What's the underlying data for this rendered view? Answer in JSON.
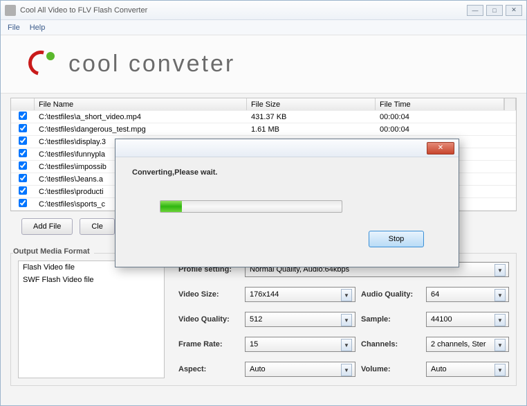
{
  "window": {
    "title": "Cool All Video to FLV Flash Converter"
  },
  "menu": {
    "file": "File",
    "help": "Help"
  },
  "logo": {
    "text": "cool conveter"
  },
  "table": {
    "headers": {
      "name": "File Name",
      "size": "File Size",
      "time": "File Time"
    },
    "rows": [
      {
        "name": "C:\\testfiles\\a_short_video.mp4",
        "size": "431.37 KB",
        "time": "00:00:04"
      },
      {
        "name": "C:\\testfiles\\dangerous_test.mpg",
        "size": "1.61 MB",
        "time": "00:00:04"
      },
      {
        "name": "C:\\testfiles\\display.3",
        "size": "",
        "time": ""
      },
      {
        "name": "C:\\testfiles\\funnypla",
        "size": "",
        "time": ""
      },
      {
        "name": "C:\\testfiles\\impossib",
        "size": "",
        "time": ""
      },
      {
        "name": "C:\\testfiles\\Jeans.a",
        "size": "",
        "time": ""
      },
      {
        "name": "C:\\testfiles\\producti",
        "size": "",
        "time": ""
      },
      {
        "name": "C:\\testfiles\\sports_c",
        "size": "",
        "time": ""
      }
    ]
  },
  "buttons": {
    "add": "Add File",
    "clear": "Cle"
  },
  "output": {
    "group": "Output Media Format",
    "formats": [
      "Flash Video file",
      "SWF Flash Video file"
    ],
    "labels": {
      "profile": "Profile setting:",
      "vsize": "Video Size:",
      "vqual": "Video Quality:",
      "frate": "Frame Rate:",
      "aspect": "Aspect:",
      "aqual": "Audio Quality:",
      "sample": "Sample:",
      "channels": "Channels:",
      "volume": "Volume:"
    },
    "values": {
      "profile": "Normal Quality, Audio:64kbps",
      "vsize": "176x144",
      "vqual": "512",
      "frate": "15",
      "aspect": "Auto",
      "aqual": "64",
      "sample": "44100",
      "channels": "2 channels, Ster",
      "volume": "Auto"
    }
  },
  "modal": {
    "message": "Converting,Please wait.",
    "stop": "Stop"
  }
}
